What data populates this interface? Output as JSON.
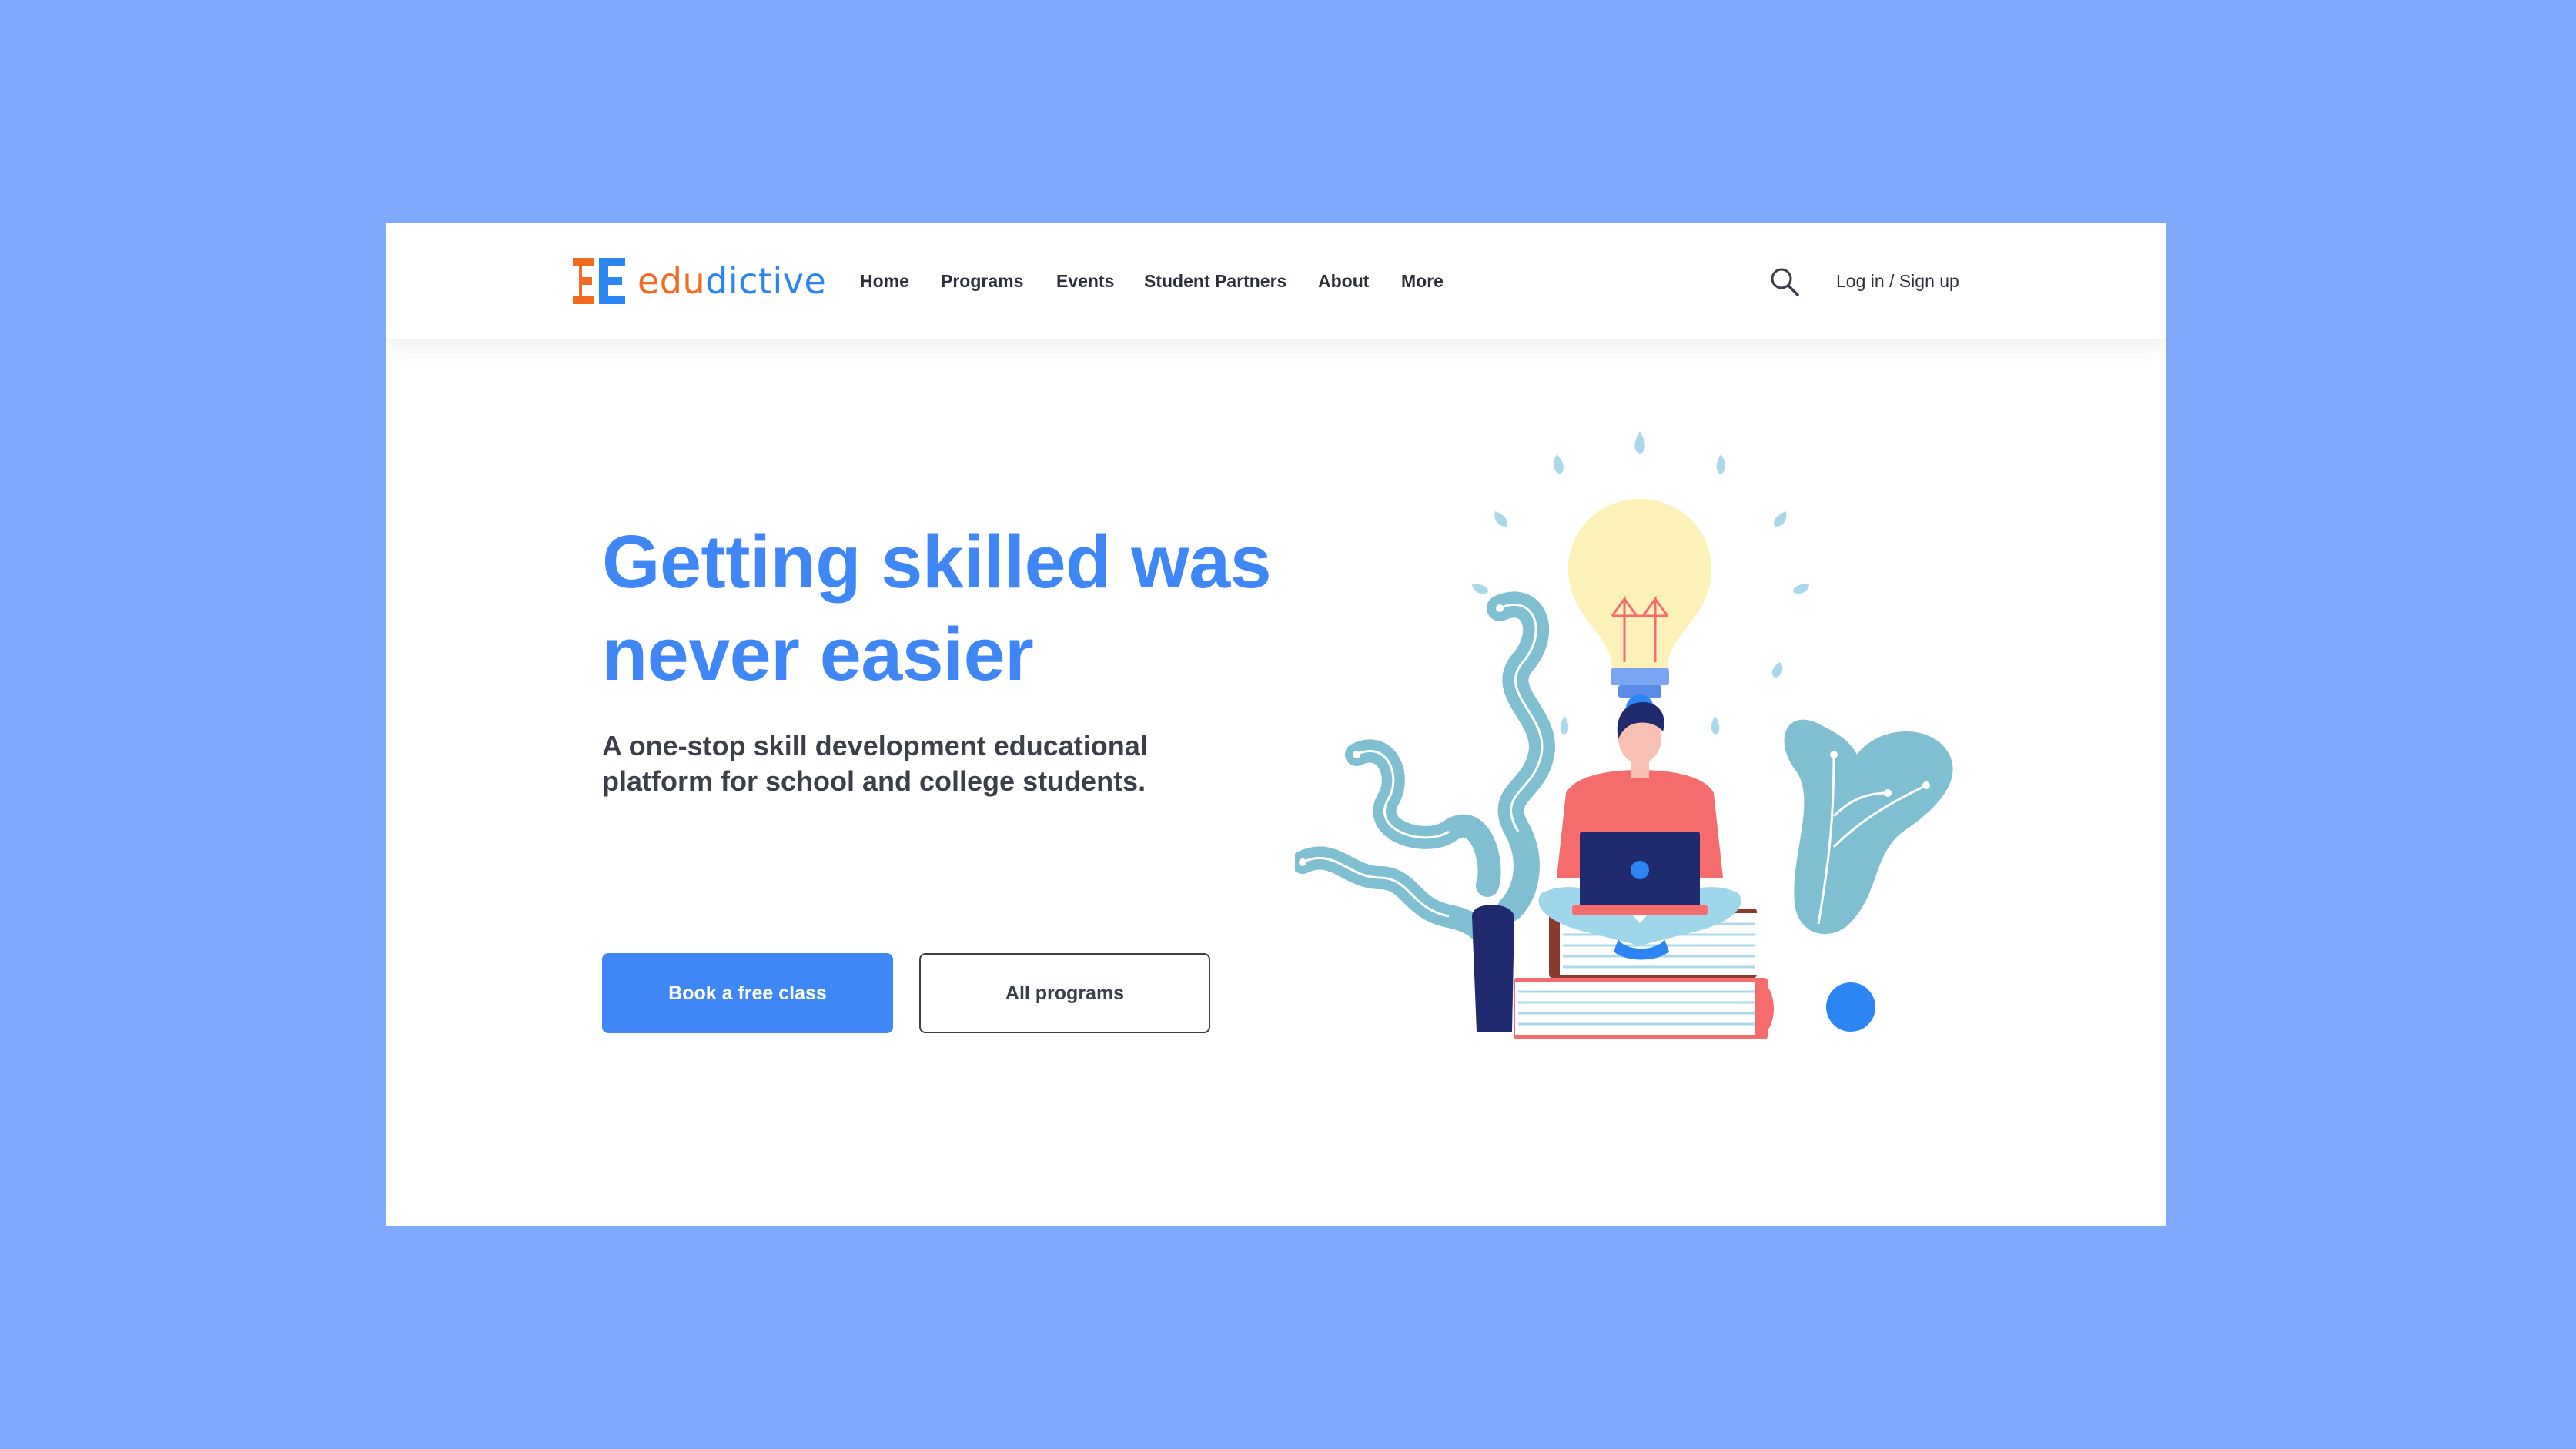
{
  "brand": {
    "name_part1": "edu",
    "name_part2": "dictive",
    "colors": {
      "orange": "#f26b21",
      "blue": "#2b86f4"
    }
  },
  "nav": {
    "items": [
      {
        "label": "Home"
      },
      {
        "label": "Programs"
      },
      {
        "label": "Events"
      },
      {
        "label": "Student Partners"
      },
      {
        "label": "About"
      },
      {
        "label": "More"
      }
    ],
    "search_icon": "search-icon",
    "login_label": "Log in / Sign up"
  },
  "hero": {
    "title": "Getting skilled was never easier",
    "subtitle": "A one-stop skill development educational platform for school and college students.",
    "primary_button": "Book a free class",
    "secondary_button": "All programs",
    "illustration": "student-reading-lightbulb-illustration"
  },
  "colors": {
    "background": "#80a9fe",
    "accent": "#3f87f6",
    "text_dark": "#2a2f3a"
  }
}
